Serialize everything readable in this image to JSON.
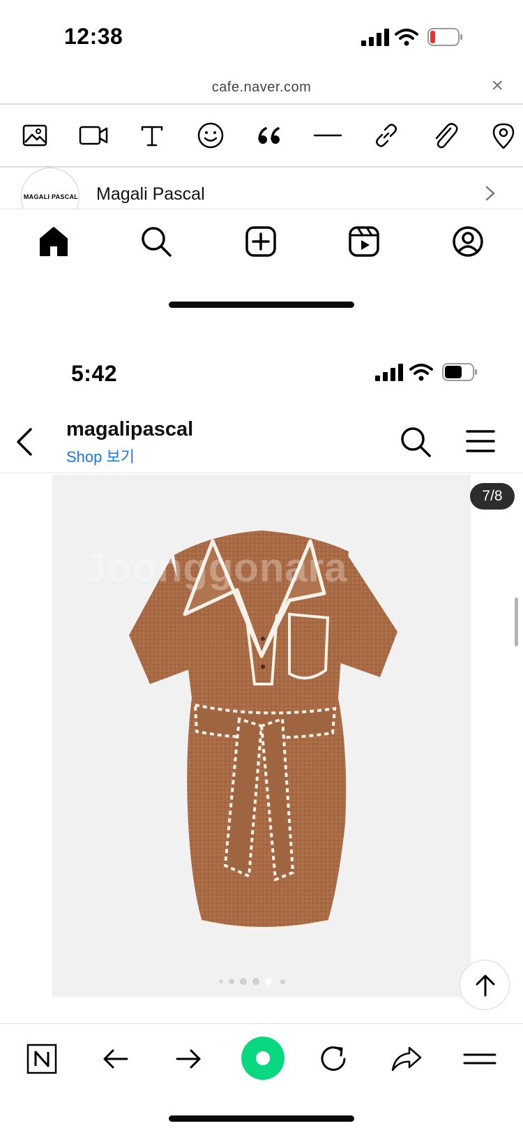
{
  "top_status": {
    "time": "12:38",
    "battery_color": "#e5342b"
  },
  "url_bar": {
    "url": "cafe.naver.com",
    "close_icon": "close-icon"
  },
  "editor_toolbar": {
    "tools": [
      "image-icon",
      "video-icon",
      "text-icon",
      "emoji-icon",
      "quote-icon",
      "divider-icon",
      "link-icon",
      "attach-icon",
      "location-icon"
    ]
  },
  "profile": {
    "avatar_text": "MAGALI PASCAL",
    "name": "Magali Pascal"
  },
  "ig_nav": {
    "items": [
      "home-icon",
      "search-icon",
      "create-icon",
      "reels-icon",
      "profile-icon"
    ]
  },
  "bottom_status": {
    "time": "5:42"
  },
  "ig_header": {
    "username": "magalipascal",
    "shop_link": "Shop 보기"
  },
  "post": {
    "counter": "7/8",
    "dots_count": 6,
    "active_dot": 4,
    "dress_color": "#a86b45",
    "trim_color": "#f7f1e8"
  },
  "browser_bar": {
    "buttons": [
      "naver-home-icon",
      "back-arrow-icon",
      "forward-arrow-icon",
      "green-dot-icon",
      "refresh-icon",
      "share-icon",
      "menu-icon"
    ]
  }
}
